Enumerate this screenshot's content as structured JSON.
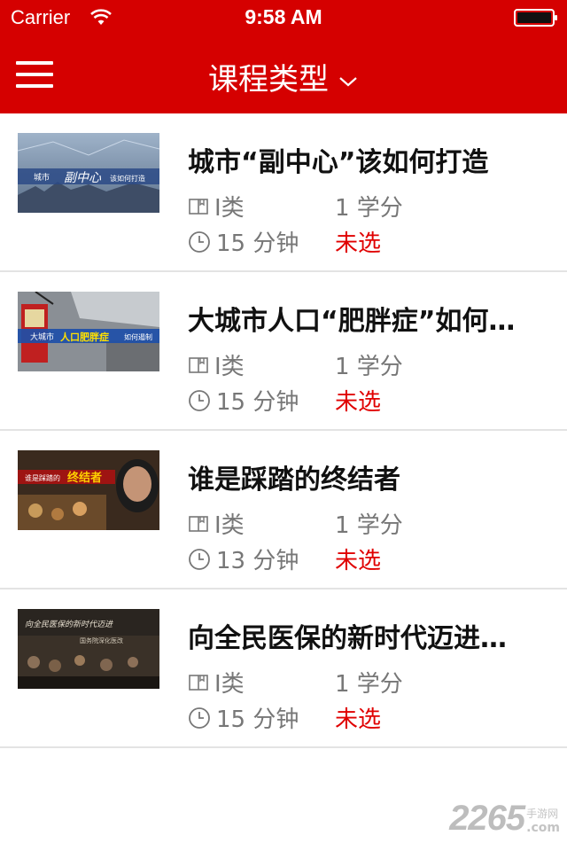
{
  "status_bar": {
    "carrier": "Carrier",
    "time": "9:58 AM"
  },
  "nav": {
    "title": "课程类型"
  },
  "courses": [
    {
      "title": "城市“副中心”该如何打造",
      "thumb_caption": "副中心",
      "thumb_sub": "城市",
      "thumb_tail": "该如何打造",
      "category": "I类",
      "credit": "1 学分",
      "duration": "15 分钟",
      "status": "未选"
    },
    {
      "title": "大城市人口“肥胖症”如何…",
      "thumb_caption": "人口肥胖症",
      "thumb_sub": "大城市",
      "thumb_tail": "如何遏制",
      "category": "I类",
      "credit": "1 学分",
      "duration": "15 分钟",
      "status": "未选"
    },
    {
      "title": "谁是踩踏的终结者",
      "thumb_caption": "终结者",
      "thumb_sub": "谁是踩踏的",
      "thumb_tail": "",
      "category": "I类",
      "credit": "1 学分",
      "duration": "13 分钟",
      "status": "未选"
    },
    {
      "title": "向全民医保的新时代迈进…",
      "thumb_caption": "向全民医保的新时代迈进",
      "thumb_sub": "",
      "thumb_tail": "国务院深化医改",
      "category": "I类",
      "credit": "1 学分",
      "duration": "15 分钟",
      "status": "未选"
    }
  ],
  "watermark": {
    "number": "2265",
    "cn": "手游网",
    "com": ".com"
  },
  "colors": {
    "brand": "#d50000",
    "status_unselected": "#e00000",
    "meta_text": "#777777"
  },
  "icons": {
    "menu": "hamburger-icon",
    "dropdown": "chevron-down-icon",
    "category": "book-icon",
    "duration": "clock-icon"
  }
}
